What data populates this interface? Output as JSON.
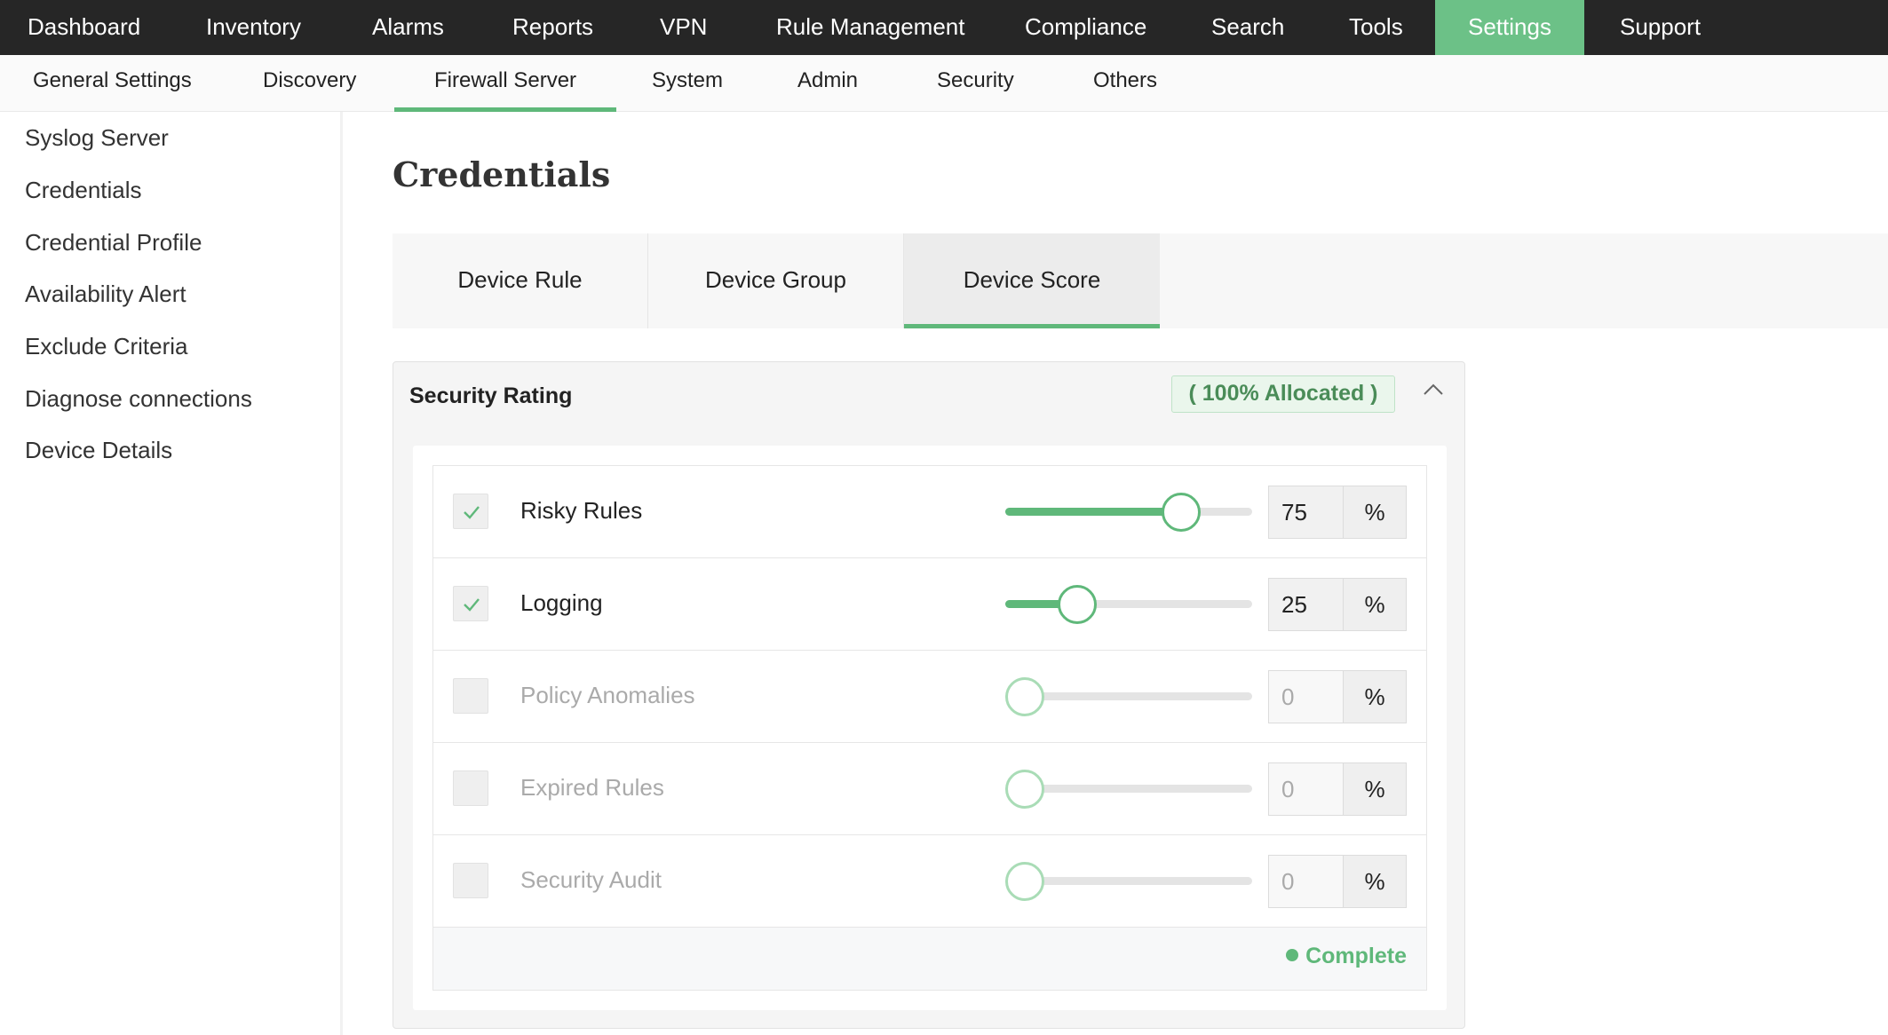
{
  "topnav": {
    "items": [
      "Dashboard",
      "Inventory",
      "Alarms",
      "Reports",
      "VPN",
      "Rule Management",
      "Compliance",
      "Search",
      "Tools",
      "Settings",
      "Support"
    ],
    "active": "Settings"
  },
  "subnav": {
    "items": [
      "General Settings",
      "Discovery",
      "Firewall Server",
      "System",
      "Admin",
      "Security",
      "Others"
    ],
    "active": "Firewall Server"
  },
  "sidebar": {
    "items": [
      "Syslog Server",
      "Credentials",
      "Credential Profile",
      "Availability Alert",
      "Exclude Criteria",
      "Diagnose connections",
      "Device Details"
    ]
  },
  "page": {
    "title": "Credentials"
  },
  "tabs": {
    "items": [
      "Device Rule",
      "Device Group",
      "Device Score"
    ],
    "active": "Device Score"
  },
  "panel": {
    "title": "Security Rating",
    "allocated": "( 100% Allocated )",
    "collapse_icon": "chevron-up-icon",
    "rows": [
      {
        "label": "Risky Rules",
        "checked": true,
        "value": "75",
        "unit": "%",
        "percent": 75
      },
      {
        "label": "Logging",
        "checked": true,
        "value": "25",
        "unit": "%",
        "percent": 25
      },
      {
        "label": "Policy Anomalies",
        "checked": false,
        "value": "0",
        "unit": "%",
        "percent": 0
      },
      {
        "label": "Expired Rules",
        "checked": false,
        "value": "0",
        "unit": "%",
        "percent": 0
      },
      {
        "label": "Security Audit",
        "checked": false,
        "value": "0",
        "unit": "%",
        "percent": 0
      }
    ],
    "status": "Complete"
  },
  "colors": {
    "accent": "#5fb87a",
    "topnav_bg": "#262626",
    "active_nav": "#6cc187",
    "allocated_text": "#4a8c58"
  }
}
